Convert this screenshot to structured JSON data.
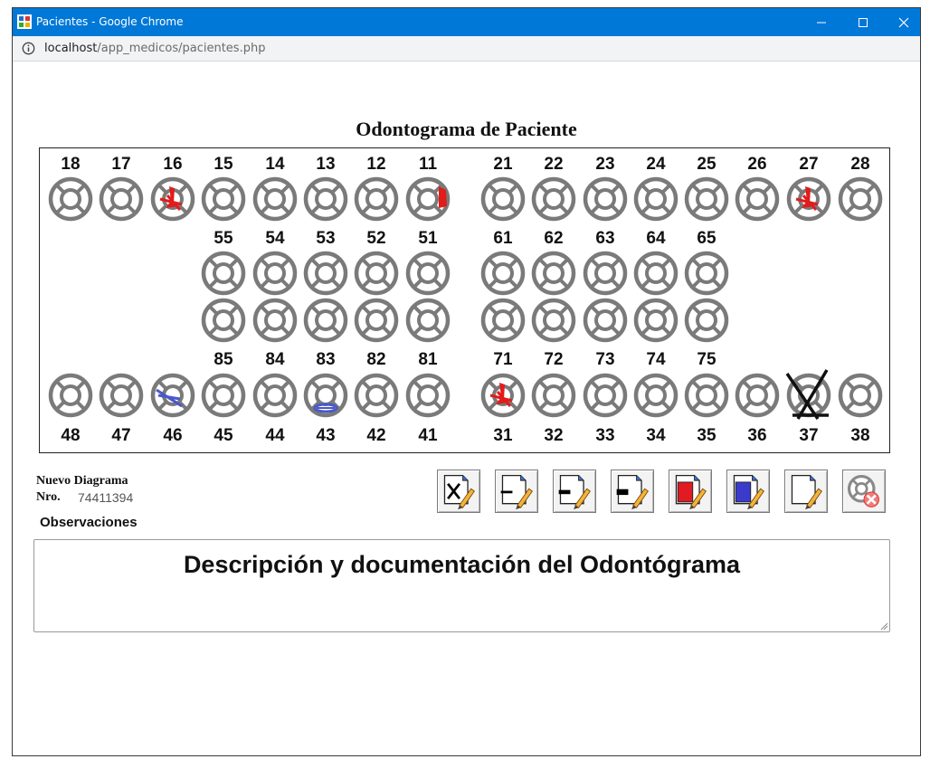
{
  "window": {
    "title": "Pacientes - Google Chrome",
    "url_host": "localhost",
    "url_path": "/app_medicos/pacientes.php"
  },
  "odontogram": {
    "title": "Odontograma de Paciente",
    "upper_permanent": [
      "18",
      "17",
      "16",
      "15",
      "14",
      "13",
      "12",
      "11",
      "21",
      "22",
      "23",
      "24",
      "25",
      "26",
      "27",
      "28"
    ],
    "upper_temporary": [
      "55",
      "54",
      "53",
      "52",
      "51",
      "61",
      "62",
      "63",
      "64",
      "65"
    ],
    "lower_temporary": [
      "85",
      "84",
      "83",
      "82",
      "81",
      "71",
      "72",
      "73",
      "74",
      "75"
    ],
    "lower_permanent": [
      "48",
      "47",
      "46",
      "45",
      "44",
      "43",
      "42",
      "41",
      "31",
      "32",
      "33",
      "34",
      "35",
      "36",
      "37",
      "38"
    ],
    "marks": [
      {
        "tooth": "16",
        "type": "red-stroke"
      },
      {
        "tooth": "11",
        "type": "red-fill"
      },
      {
        "tooth": "27",
        "type": "red-stroke"
      },
      {
        "tooth": "46",
        "type": "blue-stroke"
      },
      {
        "tooth": "43",
        "type": "blue-fill"
      },
      {
        "tooth": "31",
        "type": "red-stroke"
      },
      {
        "tooth": "37",
        "type": "black-x"
      }
    ],
    "colors": {
      "tooth": "#7a7a7a",
      "red": "#e21b1b",
      "blue": "#4a58c9",
      "black": "#111111"
    }
  },
  "form": {
    "nuevo_label": "Nuevo Diagrama",
    "nro_label": "Nro.",
    "nro_value": "74411394",
    "obs_label": "Observaciones",
    "obs_placeholder": "Descripción y documentación del Odontógrama"
  },
  "tools": [
    {
      "name": "tool-mark-missing",
      "icon": "x-document-icon"
    },
    {
      "name": "tool-line-thin",
      "icon": "dash-document-icon"
    },
    {
      "name": "tool-line-medium",
      "icon": "dash-document-icon"
    },
    {
      "name": "tool-line-thick",
      "icon": "dash-document-icon"
    },
    {
      "name": "tool-color-red",
      "icon": "red-fill-document-icon",
      "color": "#e01b22"
    },
    {
      "name": "tool-color-blue",
      "icon": "blue-fill-document-icon",
      "color": "#3a3acc"
    },
    {
      "name": "tool-eraser-white",
      "icon": "blank-document-icon"
    },
    {
      "name": "tool-clear-tooth",
      "icon": "tooth-delete-icon"
    }
  ]
}
